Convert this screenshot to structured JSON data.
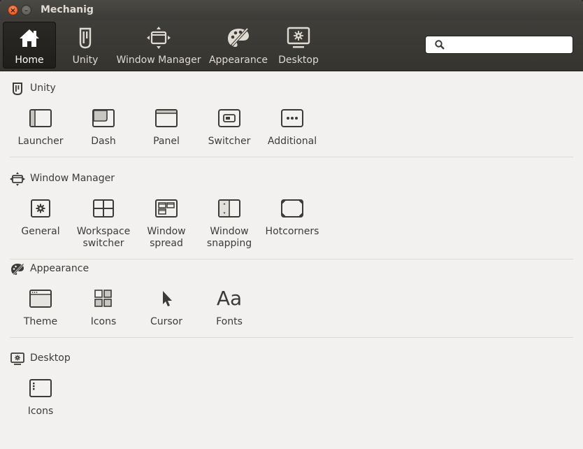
{
  "window": {
    "title": "Mechanig",
    "close_glyph": "×",
    "minimize_glyph": "–"
  },
  "toolbar": {
    "items": [
      {
        "label": "Home",
        "icon": "home-icon",
        "active": true
      },
      {
        "label": "Unity",
        "icon": "unity-icon"
      },
      {
        "label": "Window Manager",
        "icon": "window-manager-icon"
      },
      {
        "label": "Appearance",
        "icon": "appearance-icon"
      },
      {
        "label": "Desktop",
        "icon": "desktop-icon"
      }
    ]
  },
  "search": {
    "value": "",
    "placeholder": ""
  },
  "sections": [
    {
      "title": "Unity",
      "icon": "unity-icon",
      "items": [
        {
          "label": "Launcher",
          "icon": "launcher-icon"
        },
        {
          "label": "Dash",
          "icon": "dash-icon"
        },
        {
          "label": "Panel",
          "icon": "panel-icon"
        },
        {
          "label": "Switcher",
          "icon": "switcher-icon"
        },
        {
          "label": "Additional",
          "icon": "additional-icon"
        }
      ]
    },
    {
      "title": "Window Manager",
      "icon": "window-manager-icon",
      "items": [
        {
          "label": "General",
          "icon": "general-icon"
        },
        {
          "label": "Workspace\nswitcher",
          "icon": "workspace-switcher-icon"
        },
        {
          "label": "Window\nspread",
          "icon": "window-spread-icon"
        },
        {
          "label": "Window\nsnapping",
          "icon": "window-snapping-icon"
        },
        {
          "label": "Hotcorners",
          "icon": "hotcorners-icon"
        }
      ]
    },
    {
      "title": "Appearance",
      "icon": "appearance-icon",
      "items": [
        {
          "label": "Theme",
          "icon": "theme-icon"
        },
        {
          "label": "Icons",
          "icon": "icons-grid-icon"
        },
        {
          "label": "Cursor",
          "icon": "cursor-icon"
        },
        {
          "label": "Fonts",
          "icon": "fonts-icon",
          "glyph": "Aa"
        }
      ]
    },
    {
      "title": "Desktop",
      "icon": "desktop-icon",
      "items": [
        {
          "label": "Icons",
          "icon": "desktop-icons-icon"
        }
      ]
    }
  ],
  "colors": {
    "toolbar_bg": "#3c3b37",
    "content_bg": "#f2f1f0",
    "text": "#3c3b37",
    "close_button": "#df4a16"
  }
}
